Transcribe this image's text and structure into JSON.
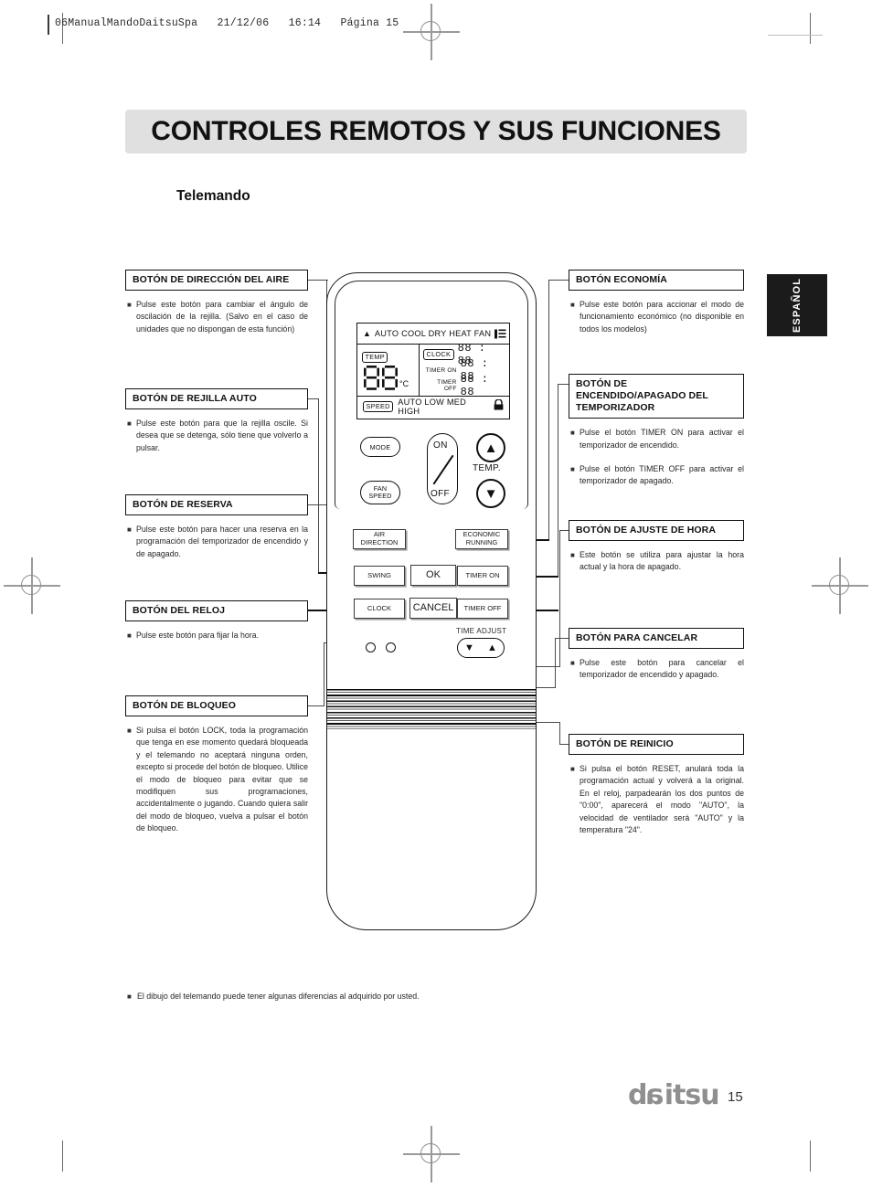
{
  "print_header": {
    "filename_stamp": "06ManualMandoDaitsuSpa   21/12/06   16:14   Página 15"
  },
  "header": {
    "title": "CONTROLES REMOTOS Y SUS FUNCIONES",
    "subtitle": "Telemando"
  },
  "language_tab": {
    "label": "ESPAÑOL"
  },
  "callouts_left": [
    {
      "caption": "BOTÓN DE DIRECCIÓN DEL AIRE",
      "items": [
        "Pulse este botón para cambiar el ángulo de oscilación de la rejilla. (Salvo en el caso de unidades que no dispongan de esta función)"
      ]
    },
    {
      "caption": "BOTÓN DE REJILLA AUTO",
      "items": [
        "Pulse este botón para que la rejilla oscile. Si desea que se detenga, sólo tiene que volverlo a pulsar."
      ]
    },
    {
      "caption": "BOTÓN DE RESERVA",
      "items": [
        "Pulse este botón para hacer una reserva en la programación del temporizador de encendido y de apagado."
      ]
    },
    {
      "caption": "BOTÓN DEL RELOJ",
      "items": [
        "Pulse este botón para fijar la hora."
      ]
    },
    {
      "caption": "BOTÓN DE BLOQUEO",
      "items": [
        "Si pulsa el botón LOCK, toda la programación que tenga en ese momento quedará bloqueada y el telemando no aceptará ninguna orden, excepto si procede del botón de bloqueo. Utilice el modo de bloqueo para evitar que se modifiquen sus programaciones, accidentalmente o jugando. Cuando quiera salir del modo de bloqueo, vuelva a pulsar el botón de bloqueo."
      ]
    }
  ],
  "callouts_right": [
    {
      "caption": "BOTÓN ECONOMÍA",
      "items": [
        "Pulse este botón para accionar el modo de funcionamiento económico (no disponible en todos los modelos)"
      ]
    },
    {
      "caption": "BOTÓN DE ENCENDIDO/APAGADO DEL TEMPORIZADOR",
      "items": [
        "Pulse el botón TIMER ON para activar el temporizador de encendido.",
        "Pulse el botón TIMER OFF para activar el temporizador de apagado."
      ]
    },
    {
      "caption": "BOTÓN DE AJUSTE DE HORA",
      "items": [
        "Este botón se utiliza para ajustar la hora actual y la hora de apagado."
      ]
    },
    {
      "caption": "BOTÓN PARA CANCELAR",
      "items": [
        "Pulse este botón para cancelar el temporizador de encendido y apagado."
      ]
    },
    {
      "caption": "BOTÓN DE REINICIO",
      "items": [
        "Si pulsa el botón RESET, anulará toda la programación actual y volverá a la original. En el reloj, parpadearán los dos puntos de \"0:00\", aparecerá el modo \"AUTO\", la velocidad de ventilador será \"AUTO\" y la temperatura \"24\"."
      ]
    }
  ],
  "remote": {
    "lcd": {
      "mode_indicator": "▲",
      "modes": "AUTO COOL DRY HEAT FAN",
      "fan_icon": "fan-flow-icon",
      "temp_pill": "TEMP",
      "temp_value": "88",
      "temp_unit": "°C",
      "clock_rows": [
        {
          "label": "CLOCK",
          "pill": true,
          "value": "88 : 88"
        },
        {
          "label": "TIMER ON",
          "pill": false,
          "value": "88 : 88"
        },
        {
          "label": "TIMER OFF",
          "pill": false,
          "value": "88 : 88"
        }
      ],
      "speed_pill": "SPEED",
      "speeds": "AUTO LOW MED HIGH",
      "lock_icon": "lock-icon"
    },
    "buttons": {
      "mode": "MODE",
      "fan_speed": "FAN\nSPEED",
      "on": "ON",
      "off": "OFF",
      "temp_label": "TEMP.",
      "temp_up": "▲",
      "temp_down": "▼"
    },
    "labeled_buttons": {
      "air_direction": "AIR\nDIRECTION",
      "economic_running": "ECONOMIC\nRUNNING",
      "swing": "SWING",
      "ok": "OK",
      "timer_on": "TIMER ON",
      "clock": "CLOCK",
      "cancel": "CANCEL",
      "timer_off": "TIMER OFF",
      "time_adjust_label": "TIME ADJUST",
      "time_adjust_down": "▼",
      "time_adjust_up": "▲"
    }
  },
  "footer": {
    "note": "El dibujo del telemando puede tener algunas diferencias al adquirido por usted.",
    "brand": "daitsu",
    "page_number": "15"
  }
}
